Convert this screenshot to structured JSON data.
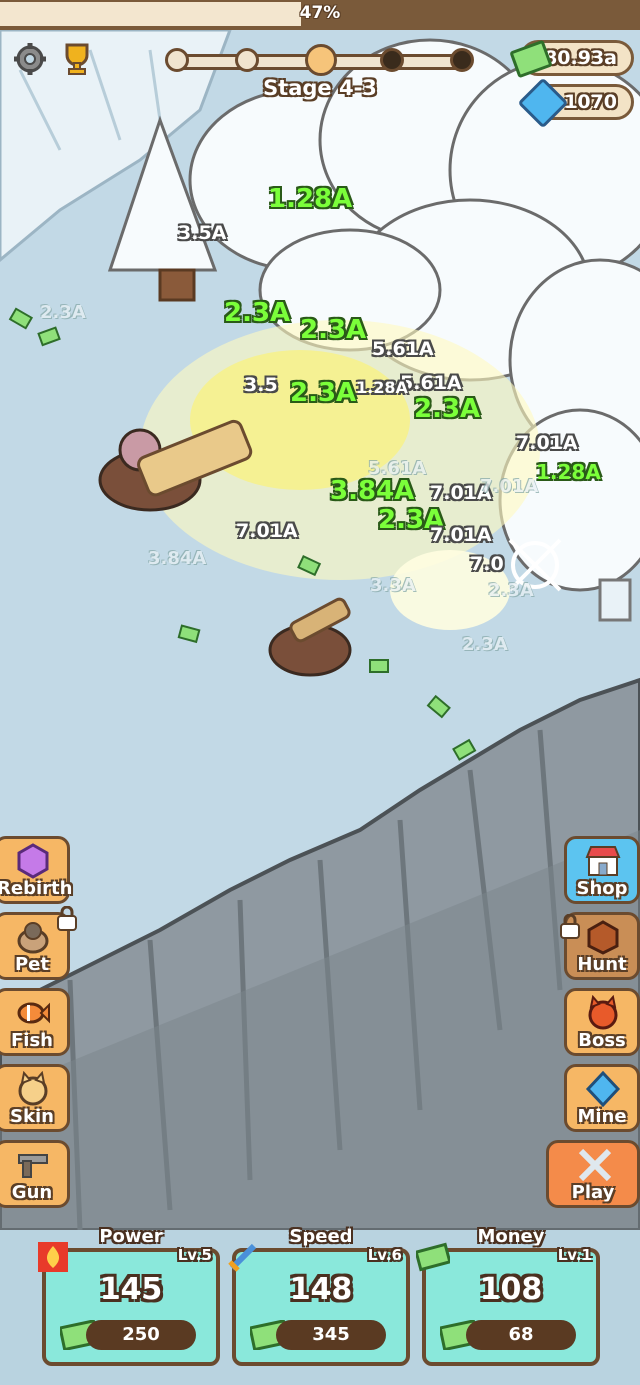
{
  "progress": {
    "percent_label": "47%",
    "fraction": 0.47
  },
  "stage": {
    "label": "Stage 4-3"
  },
  "currency": {
    "cash": "380.93a",
    "gems": "1070"
  },
  "floating_numbers": {
    "green": [
      "1.28A",
      "2.3A",
      "2.3A",
      "2.3A",
      "2.3A",
      "3.84A",
      "2.3A",
      "1.28A"
    ],
    "white": [
      "3.5A",
      "5.61A",
      "5.61A",
      "7.01A",
      "7.01A",
      "7.01A",
      "7.01A",
      "7.0",
      "1.28A",
      "3.5"
    ],
    "faint": [
      "2.3A",
      "3.84A",
      "2.3A",
      "5.61A",
      "7.01A",
      "2.3A",
      "3.3A"
    ]
  },
  "left_menu": [
    {
      "label": "Rebirth",
      "icon": "gem-icon",
      "locked": false
    },
    {
      "label": "Pet",
      "icon": "pet-icon",
      "locked": true
    },
    {
      "label": "Fish",
      "icon": "fish-icon",
      "locked": false
    },
    {
      "label": "Skin",
      "icon": "cat-skin-icon",
      "locked": false
    },
    {
      "label": "Gun",
      "icon": "pistol-icon",
      "locked": false
    }
  ],
  "right_menu": [
    {
      "label": "Shop",
      "icon": "shop-icon",
      "locked": false
    },
    {
      "label": "Hunt",
      "icon": "hunt-icon",
      "locked": true
    },
    {
      "label": "Boss",
      "icon": "boss-icon",
      "locked": false
    },
    {
      "label": "Mine",
      "icon": "diamond-icon",
      "locked": false
    },
    {
      "label": "Play",
      "icon": "crossed-swords-icon",
      "locked": false
    }
  ],
  "upgrades": [
    {
      "title": "Power",
      "level": "Lv.5",
      "value": "145",
      "cost": "250",
      "icon": "flame-icon"
    },
    {
      "title": "Speed",
      "level": "Lv.6",
      "value": "148",
      "cost": "345",
      "icon": "sword-icon"
    },
    {
      "title": "Money",
      "level": "Lv.1",
      "value": "108",
      "cost": "68",
      "icon": "cash-icon"
    }
  ],
  "colors": {
    "accent_orange": "#f6b765",
    "shop_blue": "#5cc4f0",
    "card_teal": "#8ae8db",
    "outline_brown": "#6b4b2f",
    "money_green": "#7bff3a"
  }
}
